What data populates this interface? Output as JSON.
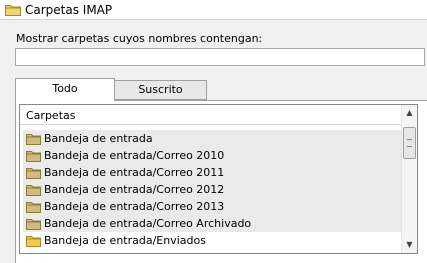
{
  "window": {
    "title": "Carpetas IMAP",
    "icon": "folder-icon"
  },
  "filter": {
    "label": "Mostrar carpetas cuyos nombres contengan:",
    "value": "",
    "placeholder": ""
  },
  "tabs": [
    {
      "label": "Todo",
      "selected": true
    },
    {
      "label": "Suscrito",
      "selected": false
    }
  ],
  "list": {
    "column_header": "Carpetas",
    "items": [
      {
        "label": "Bandeja de entrada",
        "icon": "folder-icon"
      },
      {
        "label": "Bandeja de entrada/Correo 2010",
        "icon": "folder-icon"
      },
      {
        "label": "Bandeja de entrada/Correo 2011",
        "icon": "folder-icon"
      },
      {
        "label": "Bandeja de entrada/Correo 2012",
        "icon": "folder-icon"
      },
      {
        "label": "Bandeja de entrada/Correo 2013",
        "icon": "folder-icon"
      },
      {
        "label": "Bandeja de entrada/Correo Archivado",
        "icon": "folder-icon"
      },
      {
        "label": "Bandeja de entrada/Enviados",
        "icon": "folder-icon"
      }
    ]
  },
  "colors": {
    "folder": "#c8b46a",
    "folder_open": "#f2c94c",
    "row_bg": "#eaeaea"
  }
}
